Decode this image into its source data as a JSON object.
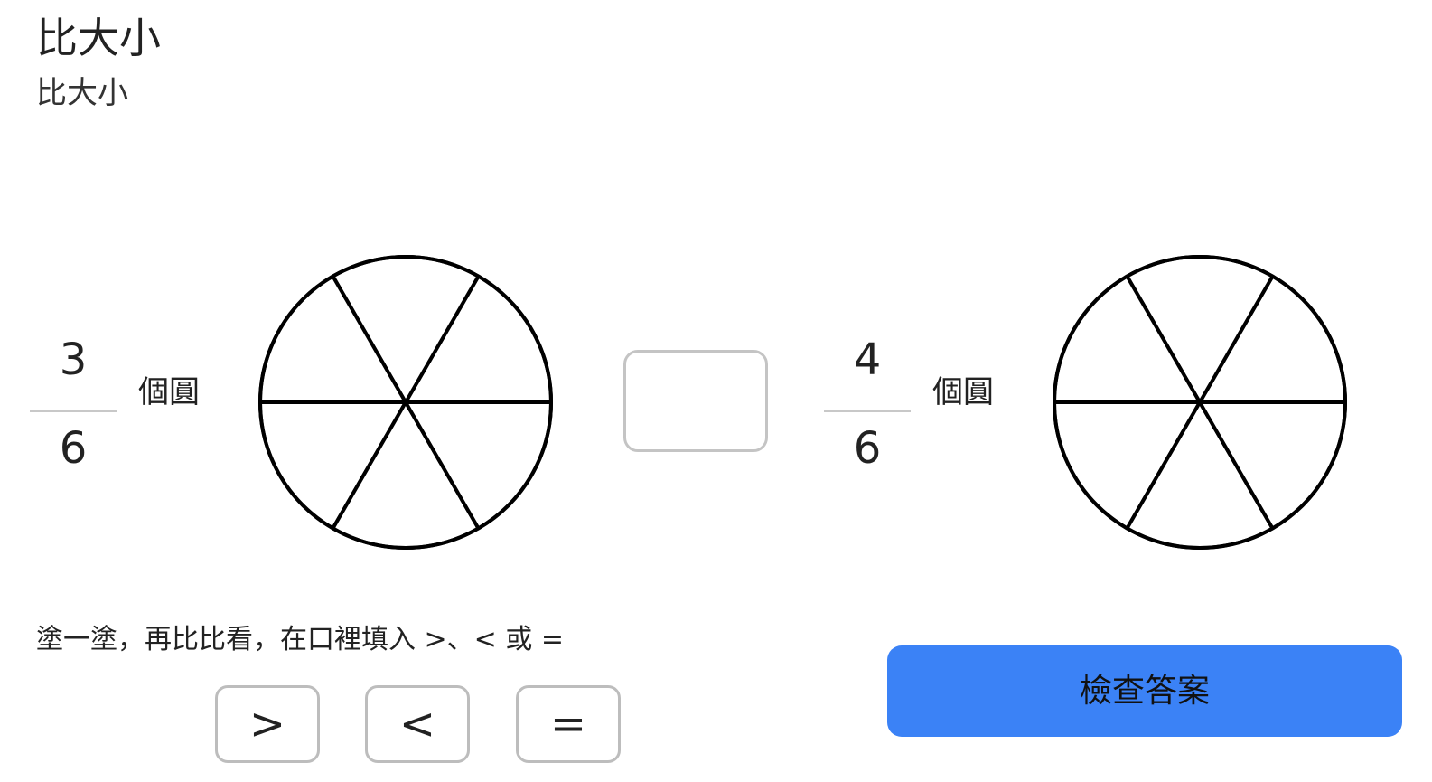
{
  "header": {
    "title": "比大小",
    "subtitle": "比大小"
  },
  "left": {
    "numerator": "3",
    "denominator": "6",
    "unit_label": "個圓",
    "slices": 6,
    "filled_slices": 0
  },
  "answer_box": {
    "value": ""
  },
  "right": {
    "numerator": "4",
    "denominator": "6",
    "unit_label": "個圓",
    "slices": 6,
    "filled_slices": 0
  },
  "instruction": "塗一塗，再比比看，在口裡填入 >、< 或 =",
  "symbol_buttons": [
    ">",
    "<",
    "="
  ],
  "check_button_label": "檢查答案",
  "colors": {
    "check_button_bg": "#3b82f6",
    "pie_stroke": "#000000",
    "border_gray": "#c4c4c4"
  }
}
